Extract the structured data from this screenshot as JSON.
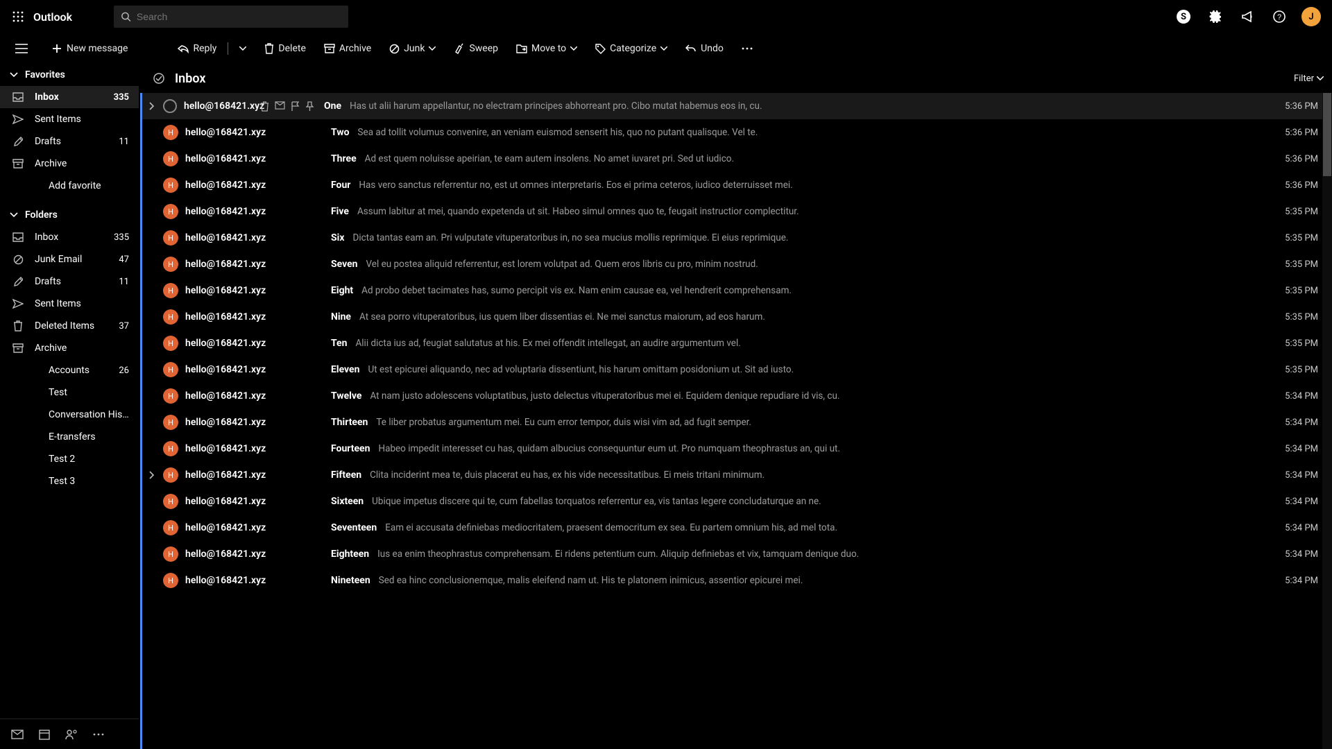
{
  "brand": "Outlook",
  "search": {
    "placeholder": "Search"
  },
  "header_icons": [
    "skype",
    "settings",
    "megaphone",
    "help",
    "avatar"
  ],
  "avatar_initial": "J",
  "toolbar": {
    "hamburger": true,
    "new_message": "New message",
    "reply": "Reply",
    "delete": "Delete",
    "archive": "Archive",
    "junk": "Junk",
    "sweep": "Sweep",
    "move_to": "Move to",
    "categorize": "Categorize",
    "undo": "Undo"
  },
  "nav": {
    "favorites_label": "Favorites",
    "favorites": [
      {
        "icon": "inbox",
        "label": "Inbox",
        "count": "335",
        "active": true
      },
      {
        "icon": "sent",
        "label": "Sent Items"
      },
      {
        "icon": "drafts",
        "label": "Drafts",
        "count": "11"
      },
      {
        "icon": "archive",
        "label": "Archive"
      },
      {
        "icon": "",
        "label": "Add favorite"
      }
    ],
    "folders_label": "Folders",
    "folders": [
      {
        "icon": "inbox",
        "label": "Inbox",
        "count": "335"
      },
      {
        "icon": "junk",
        "label": "Junk Email",
        "count": "47"
      },
      {
        "icon": "drafts",
        "label": "Drafts",
        "count": "11"
      },
      {
        "icon": "sent",
        "label": "Sent Items"
      },
      {
        "icon": "trash",
        "label": "Deleted Items",
        "count": "37"
      },
      {
        "icon": "archive",
        "label": "Archive"
      },
      {
        "icon": "",
        "label": "Accounts",
        "count": "26"
      },
      {
        "icon": "",
        "label": "Test"
      },
      {
        "icon": "",
        "label": "Conversation Hist…"
      },
      {
        "icon": "",
        "label": "E-transfers"
      },
      {
        "icon": "",
        "label": "Test 2"
      },
      {
        "icon": "",
        "label": "Test 3"
      }
    ]
  },
  "pane": {
    "title": "Inbox",
    "filter": "Filter"
  },
  "messages": [
    {
      "from": "hello@168421.xyz",
      "subject": "One",
      "preview": "Has ut alii harum appellantur, no electram principes abhorreant pro. Cibo mutat habemus eos in, cu.",
      "time": "5:36 PM",
      "hover": true,
      "expand": true
    },
    {
      "from": "hello@168421.xyz",
      "subject": "Two",
      "preview": "Sea ad tollit volumus convenire, an veniam euismod senserit his, quo no putant qualisque. Vel te.",
      "time": "5:36 PM"
    },
    {
      "from": "hello@168421.xyz",
      "subject": "Three",
      "preview": "Ad est quem noluisse apeirian, te eam autem insolens. No amet iuvaret pri. Sed ut iudico.",
      "time": "5:36 PM"
    },
    {
      "from": "hello@168421.xyz",
      "subject": "Four",
      "preview": "Has vero sanctus referrentur no, est ut omnes interpretaris. Eos ei prima ceteros, iudico deterruisset mei.",
      "time": "5:36 PM"
    },
    {
      "from": "hello@168421.xyz",
      "subject": "Five",
      "preview": "Assum labitur at mei, quando expetenda ut sit. Habeo simul omnes quo te, feugait instructior complectitur.",
      "time": "5:35 PM"
    },
    {
      "from": "hello@168421.xyz",
      "subject": "Six",
      "preview": "Dicta tantas eam an. Pri vulputate vituperatoribus in, no sea mucius mollis reprimique. Ei eius reprimique.",
      "time": "5:35 PM"
    },
    {
      "from": "hello@168421.xyz",
      "subject": "Seven",
      "preview": "Vel eu postea aliquid referrentur, est lorem volutpat ad. Quem eros libris cu pro, minim nostrud.",
      "time": "5:35 PM"
    },
    {
      "from": "hello@168421.xyz",
      "subject": "Eight",
      "preview": "Ad probo debet tacimates has, sumo percipit vis ex. Nam enim causae ea, vel hendrerit comprehensam.",
      "time": "5:35 PM"
    },
    {
      "from": "hello@168421.xyz",
      "subject": "Nine",
      "preview": "At sea porro vituperatoribus, ius quem liber dissentias ei. Ne mei sanctus maiorum, ad eos harum.",
      "time": "5:35 PM"
    },
    {
      "from": "hello@168421.xyz",
      "subject": "Ten",
      "preview": "Alii dicta ius ad, feugiat salutatus at his. Ex mei offendit intellegat, an audire argumentum vel.",
      "time": "5:35 PM"
    },
    {
      "from": "hello@168421.xyz",
      "subject": "Eleven",
      "preview": "Ut est epicurei aliquando, nec ad voluptaria dissentiunt, his harum omittam posidonium ut. Sit ad iusto.",
      "time": "5:35 PM"
    },
    {
      "from": "hello@168421.xyz",
      "subject": "Twelve",
      "preview": "At nam justo adolescens voluptatibus, justo delectus vituperatoribus mei ei. Equidem denique repudiare id vis, cu.",
      "time": "5:34 PM"
    },
    {
      "from": "hello@168421.xyz",
      "subject": "Thirteen",
      "preview": "Te liber probatus argumentum mei. Eu cum error tempor, duis wisi vim ad, ad fugit semper.",
      "time": "5:34 PM"
    },
    {
      "from": "hello@168421.xyz",
      "subject": "Fourteen",
      "preview": "Habeo impedit interesset cu has, quidam albucius consequuntur eum ut. Pro numquam theophrastus an, qui ut.",
      "time": "5:34 PM"
    },
    {
      "from": "hello@168421.xyz",
      "subject": "Fifteen",
      "preview": "Clita inciderint mea te, duis placerat eu has, ex his vide necessitatibus. Ei meis tritani minimum.",
      "time": "5:34 PM",
      "expand": true
    },
    {
      "from": "hello@168421.xyz",
      "subject": "Sixteen",
      "preview": "Ubique impetus discere qui te, cum fabellas torquatos referrentur ea, vis tantas legere concludaturque an ne.",
      "time": "5:34 PM"
    },
    {
      "from": "hello@168421.xyz",
      "subject": "Seventeen",
      "preview": "Eam ei accusata definiebas mediocritatem, praesent democritum ex sea. Eu partem omnium his, ad mel tota.",
      "time": "5:34 PM"
    },
    {
      "from": "hello@168421.xyz",
      "subject": "Eighteen",
      "preview": "Ius ea enim theophrastus comprehensam. Ei ridens petentium cum. Aliquip definiebas et vix, tamquam denique duo.",
      "time": "5:34 PM"
    },
    {
      "from": "hello@168421.xyz",
      "subject": "Nineteen",
      "preview": "Sed ea hinc conclusionemque, malis eleifend nam ut. His te platonem inimicus, assentior epicurei mei.",
      "time": "5:34 PM"
    }
  ]
}
